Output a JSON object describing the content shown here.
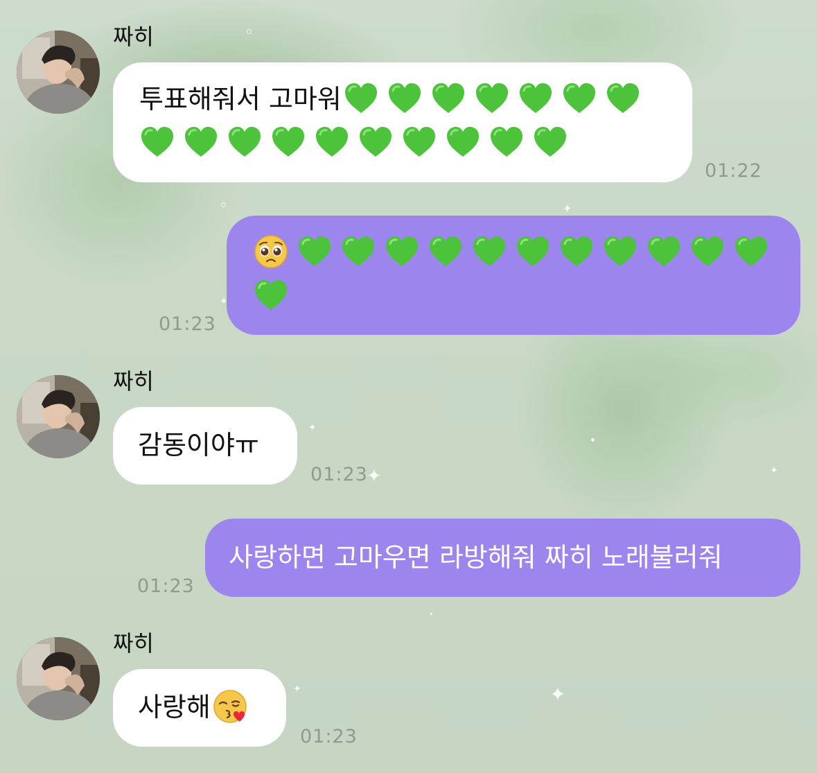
{
  "theme": {
    "incoming_bubble_color": "#ffffff",
    "outgoing_bubble_color": "#9c86ee",
    "timestamp_color": "#8f9a8c",
    "heart_color": "#4cc33b"
  },
  "messages": [
    {
      "direction": "incoming",
      "sender": "짜히",
      "text": "투표해줘서 고마워",
      "emoji": [
        "green-heart-emoji",
        "green-heart-emoji",
        "green-heart-emoji",
        "green-heart-emoji",
        "green-heart-emoji",
        "green-heart-emoji",
        "green-heart-emoji",
        "green-heart-emoji",
        "green-heart-emoji",
        "green-heart-emoji",
        "green-heart-emoji",
        "green-heart-emoji",
        "green-heart-emoji",
        "green-heart-emoji",
        "green-heart-emoji",
        "green-heart-emoji",
        "green-heart-emoji"
      ],
      "time": "01:22"
    },
    {
      "direction": "outgoing",
      "emoji": [
        "pleading-face-emoji",
        "green-heart-emoji",
        "green-heart-emoji",
        "green-heart-emoji",
        "green-heart-emoji",
        "green-heart-emoji",
        "green-heart-emoji",
        "green-heart-emoji",
        "green-heart-emoji",
        "green-heart-emoji",
        "green-heart-emoji",
        "green-heart-emoji",
        "green-heart-emoji"
      ],
      "time": "01:23"
    },
    {
      "direction": "incoming",
      "sender": "짜히",
      "text": "감동이야ㅠ",
      "time": "01:23"
    },
    {
      "direction": "outgoing",
      "text": "사랑하면 고마우면 라방해줘 짜히 노래불러줘",
      "time": "01:23"
    },
    {
      "direction": "incoming",
      "sender": "짜히",
      "text": "사랑해",
      "emoji": [
        "face-blowing-kiss-emoji"
      ],
      "time": "01:23"
    }
  ]
}
